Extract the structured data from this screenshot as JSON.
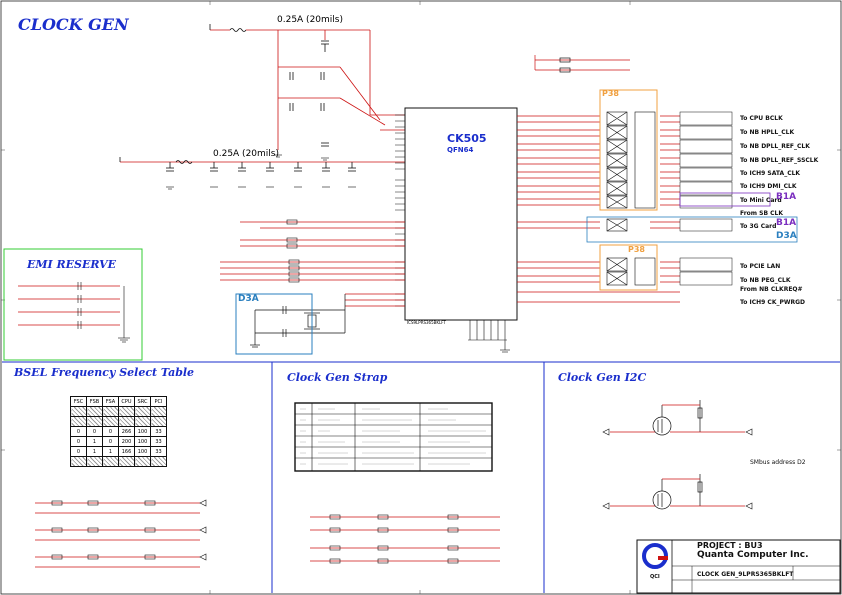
{
  "sheet": {
    "title": "CLOCK GEN",
    "current_note_1": "0.25A (20mils)",
    "current_note_2": "0.25A (20mils)",
    "chip_name": "CK505",
    "chip_package": "QFN64",
    "chip_part": "ICS9LPRS365BKLFT"
  },
  "outputs": [
    "To CPU BCLK",
    "To NB HPLL_CLK",
    "To NB DPLL_REF_CLK",
    "To NB DPLL_REF_SSCLK",
    "To ICH9 SATA_CLK",
    "To ICH9 DMI_CLK",
    "To Mini Card",
    "From SB CLK",
    "To 3G Card",
    "To PCIE LAN",
    "To NB PEG_CLK",
    "From NB CLKREQ#",
    "To ICH9 CK_PWRGD"
  ],
  "page_refs": {
    "p38_top": "P38",
    "p38_mid": "P38",
    "b1a_1": "B1A",
    "b1a_2": "B1A",
    "d3a_right": "D3A",
    "d3a_left": "D3A"
  },
  "sections": {
    "emi": "EMI RESERVE",
    "bsel": "BSEL Frequency Select Table",
    "strap": "Clock Gen Strap",
    "i2c": "Clock Gen I2C"
  },
  "bsel_table": {
    "headers": [
      "FSC",
      "FSB",
      "FSA",
      "CPU",
      "SRC",
      "PCI"
    ],
    "rows": [
      [
        "0",
        "0",
        "0",
        "266",
        "100",
        "33"
      ],
      [
        "0",
        "1",
        "0",
        "200",
        "100",
        "33"
      ],
      [
        "0",
        "1",
        "1",
        "166",
        "100",
        "33"
      ]
    ]
  },
  "i2c": {
    "smbus_address": "SMbus address D2"
  },
  "title_block": {
    "project": "PROJECT : BU3",
    "company": "Quanta Computer Inc.",
    "doc_title": "CLOCK GEN_9LPRS365BKLFT",
    "logo_text": "QCI"
  },
  "colors": {
    "title_blue": "#1a2ecc",
    "wire_red": "#cc1111",
    "emi_box": "#33cc33",
    "p38_box": "#f0a040",
    "b1a_box": "#7b2fbf",
    "d3a_box": "#2a7fbf",
    "divider": "#1a2ecc"
  }
}
